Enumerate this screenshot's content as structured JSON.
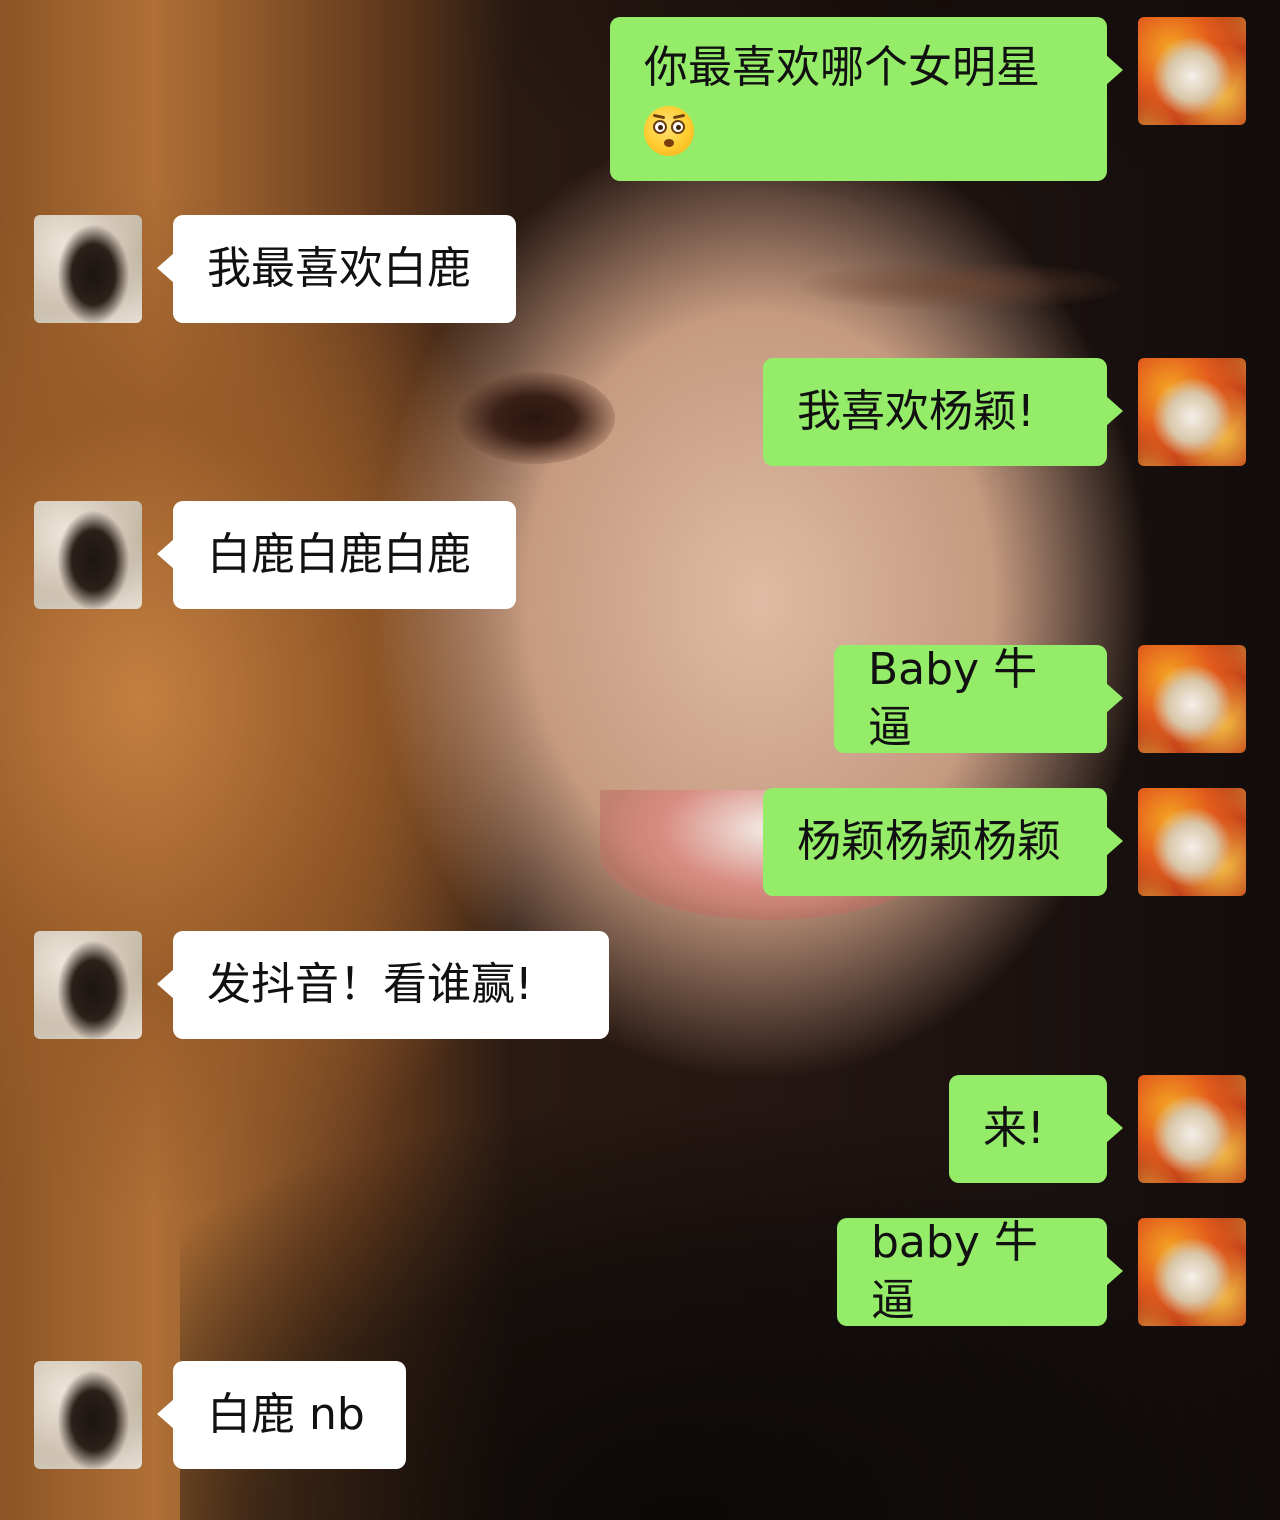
{
  "messages": [
    {
      "side": "out",
      "text": "你最喜欢哪个女明星",
      "emoji": "flushed-face-emoji"
    },
    {
      "side": "in",
      "text": "我最喜欢白鹿"
    },
    {
      "side": "out",
      "text": "我喜欢杨颖!"
    },
    {
      "side": "in",
      "text": "白鹿白鹿白鹿"
    },
    {
      "side": "out",
      "text": "Baby 牛逼"
    },
    {
      "side": "out",
      "text": "杨颖杨颖杨颖"
    },
    {
      "side": "in",
      "text": "发抖音！看谁赢!"
    },
    {
      "side": "out",
      "text": "来!"
    },
    {
      "side": "out",
      "text": "baby 牛逼"
    },
    {
      "side": "in",
      "text": "白鹿 nb"
    }
  ],
  "colors": {
    "outgoing_bubble": "#95ec69",
    "incoming_bubble": "#ffffff",
    "text": "#111111"
  },
  "avatars": {
    "me": "fire-fox-warrior-avatar",
    "her": "woman-photo-avatar"
  }
}
